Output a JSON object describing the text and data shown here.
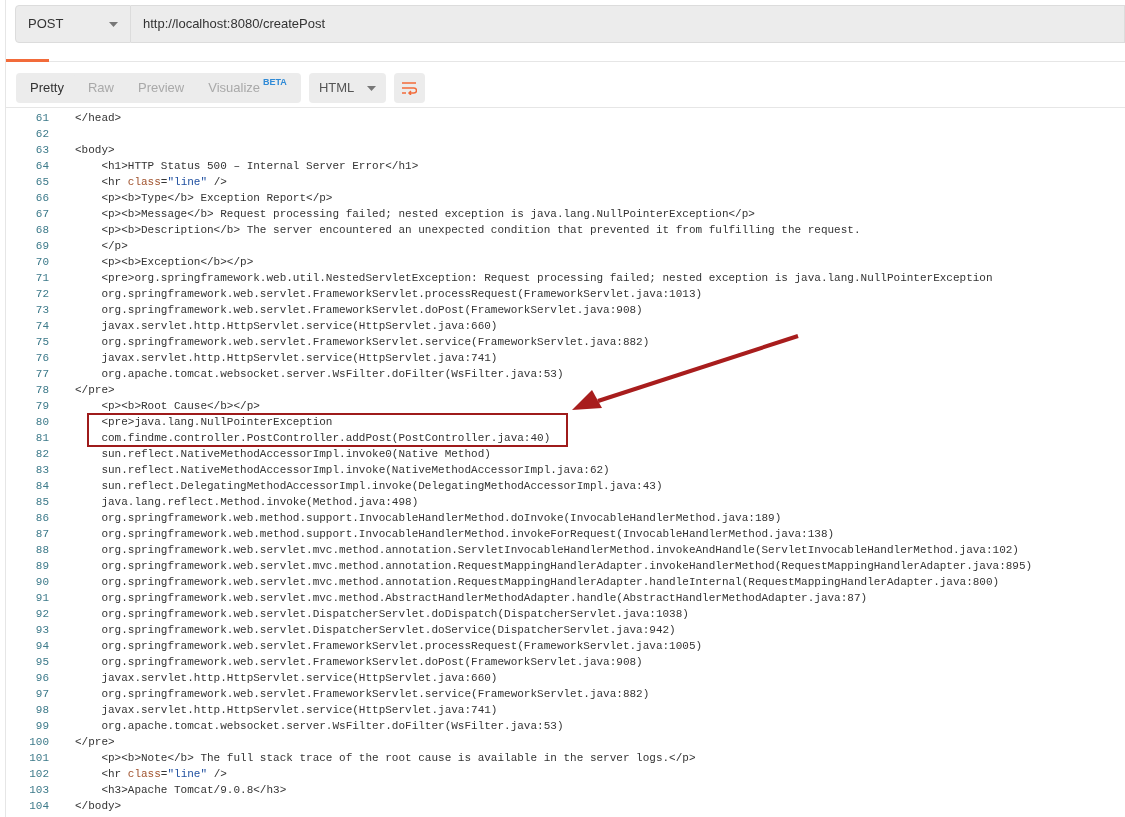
{
  "request": {
    "method": "POST",
    "url": "http://localhost:8080/createPost"
  },
  "response_tabs": [
    {
      "label": "Pretty",
      "selected": true
    },
    {
      "label": "Raw",
      "selected": false
    },
    {
      "label": "Preview",
      "selected": false
    },
    {
      "label": "Visualize",
      "selected": false,
      "badge": "BETA"
    }
  ],
  "format": "HTML",
  "code_lines": [
    {
      "number": "61",
      "text": "</head>",
      "boxed": false
    },
    {
      "number": "62",
      "boxed": false
    },
    {
      "number": "63",
      "text": "<body>",
      "boxed": false
    },
    {
      "number": "64",
      "text": "    <h1>HTTP Status 500 – Internal Server Error</h1>",
      "boxed": false
    },
    {
      "number": "65",
      "text": "    <hr class=\"line\" />",
      "boxed": false
    },
    {
      "number": "66",
      "text": "    <p><b>Type</b> Exception Report</p>",
      "boxed": false
    },
    {
      "number": "67",
      "text": "    <p><b>Message</b> Request processing failed; nested exception is java.lang.NullPointerException</p>",
      "boxed": false
    },
    {
      "number": "68",
      "text": "    <p><b>Description</b> The server encountered an unexpected condition that prevented it from fulfilling the request.",
      "boxed": false
    },
    {
      "number": "69",
      "text": "    </p>",
      "boxed": false
    },
    {
      "number": "70",
      "text": "    <p><b>Exception</b></p>",
      "boxed": false
    },
    {
      "number": "71",
      "text": "    <pre>org.springframework.web.util.NestedServletException: Request processing failed; nested exception is java.lang.NullPointerException",
      "boxed": false
    },
    {
      "number": "72",
      "text": "    org.springframework.web.servlet.FrameworkServlet.processRequest(FrameworkServlet.java:1013)",
      "boxed": false
    },
    {
      "number": "73",
      "text": "    org.springframework.web.servlet.FrameworkServlet.doPost(FrameworkServlet.java:908)",
      "boxed": false
    },
    {
      "number": "74",
      "text": "    javax.servlet.http.HttpServlet.service(HttpServlet.java:660)",
      "boxed": false
    },
    {
      "number": "75",
      "text": "    org.springframework.web.servlet.FrameworkServlet.service(FrameworkServlet.java:882)",
      "boxed": false
    },
    {
      "number": "76",
      "text": "    javax.servlet.http.HttpServlet.service(HttpServlet.java:741)",
      "boxed": false
    },
    {
      "number": "77",
      "text": "    org.apache.tomcat.websocket.server.WsFilter.doFilter(WsFilter.java:53)",
      "boxed": false
    },
    {
      "number": "78",
      "text": "</pre>",
      "boxed": false
    },
    {
      "number": "79",
      "text": "    <p><b>Root Cause</b></p>",
      "boxed": false
    },
    {
      "number": "80",
      "text": "    <pre>java.lang.NullPointerException",
      "boxed": true
    },
    {
      "number": "81",
      "text": "    com.findme.controller.PostController.addPost(PostController.java:40)",
      "boxed": true
    },
    {
      "number": "82",
      "text": "    sun.reflect.NativeMethodAccessorImpl.invoke0(Native Method)",
      "boxed": false
    },
    {
      "number": "83",
      "text": "    sun.reflect.NativeMethodAccessorImpl.invoke(NativeMethodAccessorImpl.java:62)",
      "boxed": false
    },
    {
      "number": "84",
      "text": "    sun.reflect.DelegatingMethodAccessorImpl.invoke(DelegatingMethodAccessorImpl.java:43)",
      "boxed": false
    },
    {
      "number": "85",
      "text": "    java.lang.reflect.Method.invoke(Method.java:498)",
      "boxed": false
    },
    {
      "number": "86",
      "text": "    org.springframework.web.method.support.InvocableHandlerMethod.doInvoke(InvocableHandlerMethod.java:189)",
      "boxed": false
    },
    {
      "number": "87",
      "text": "    org.springframework.web.method.support.InvocableHandlerMethod.invokeForRequest(InvocableHandlerMethod.java:138)",
      "boxed": false
    },
    {
      "number": "88",
      "text": "    org.springframework.web.servlet.mvc.method.annotation.ServletInvocableHandlerMethod.invokeAndHandle(ServletInvocableHandlerMethod.java:102)",
      "boxed": false
    },
    {
      "number": "89",
      "text": "    org.springframework.web.servlet.mvc.method.annotation.RequestMappingHandlerAdapter.invokeHandlerMethod(RequestMappingHandlerAdapter.java:895)",
      "boxed": false
    },
    {
      "number": "90",
      "text": "    org.springframework.web.servlet.mvc.method.annotation.RequestMappingHandlerAdapter.handleInternal(RequestMappingHandlerAdapter.java:800)",
      "boxed": false
    },
    {
      "number": "91",
      "text": "    org.springframework.web.servlet.mvc.method.AbstractHandlerMethodAdapter.handle(AbstractHandlerMethodAdapter.java:87)",
      "boxed": false
    },
    {
      "number": "92",
      "text": "    org.springframework.web.servlet.DispatcherServlet.doDispatch(DispatcherServlet.java:1038)",
      "boxed": false
    },
    {
      "number": "93",
      "text": "    org.springframework.web.servlet.DispatcherServlet.doService(DispatcherServlet.java:942)",
      "boxed": false
    },
    {
      "number": "94",
      "text": "    org.springframework.web.servlet.FrameworkServlet.processRequest(FrameworkServlet.java:1005)",
      "boxed": false
    },
    {
      "number": "95",
      "text": "    org.springframework.web.servlet.FrameworkServlet.doPost(FrameworkServlet.java:908)",
      "boxed": false
    },
    {
      "number": "96",
      "text": "    javax.servlet.http.HttpServlet.service(HttpServlet.java:660)",
      "boxed": false
    },
    {
      "number": "97",
      "text": "    org.springframework.web.servlet.FrameworkServlet.service(FrameworkServlet.java:882)",
      "boxed": false
    },
    {
      "number": "98",
      "text": "    javax.servlet.http.HttpServlet.service(HttpServlet.java:741)",
      "boxed": false
    },
    {
      "number": "99",
      "text": "    org.apache.tomcat.websocket.server.WsFilter.doFilter(WsFilter.java:53)",
      "boxed": false
    },
    {
      "number": "100",
      "text": "</pre>",
      "boxed": false
    },
    {
      "number": "101",
      "text": "    <p><b>Note</b> The full stack trace of the root cause is available in the server logs.</p>",
      "boxed": false
    },
    {
      "number": "102",
      "text": "    <hr class=\"line\" />",
      "boxed": false
    },
    {
      "number": "103",
      "text": "    <h3>Apache Tomcat/9.0.8</h3>",
      "boxed": false
    },
    {
      "number": "104",
      "text": "</body>",
      "boxed": false
    }
  ]
}
